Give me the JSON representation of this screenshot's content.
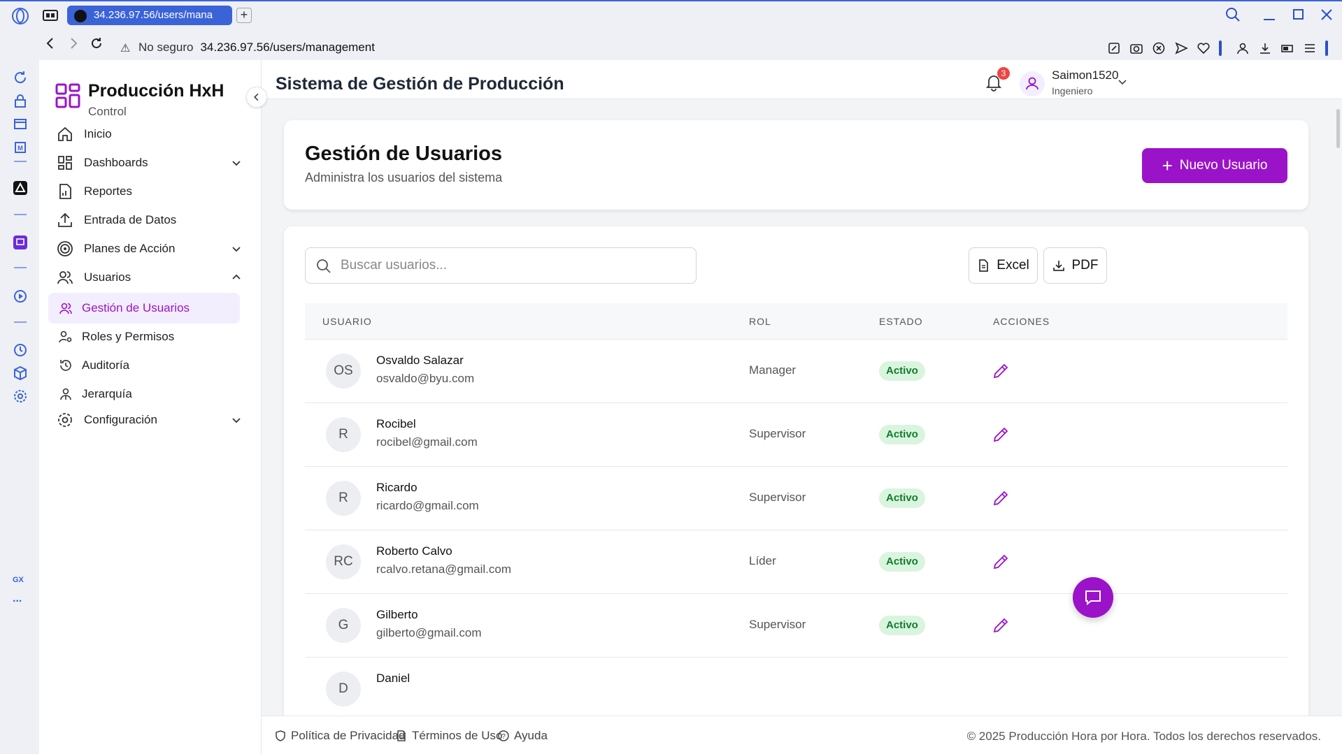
{
  "browser": {
    "tab_title": "34.236.97.56/users/mana",
    "security_label": "No seguro",
    "url": "34.236.97.56/users/management",
    "opera_sidebar_icons": [
      "history-icon",
      "shopping-icon",
      "calendar-icon",
      "manager-icon",
      "aria-icon",
      "twitch-icon",
      "player-icon",
      "clock-icon",
      "cube-icon",
      "settings-icon"
    ],
    "gx_label": "GX",
    "more_label": "..."
  },
  "brand": {
    "title": "Producción HxH",
    "subtitle": "Control"
  },
  "sidebar": {
    "items": [
      {
        "label": "Inicio",
        "icon": "home-icon"
      },
      {
        "label": "Dashboards",
        "icon": "dashboard-icon"
      },
      {
        "label": "Reportes",
        "icon": "report-icon"
      },
      {
        "label": "Entrada de Datos",
        "icon": "upload-icon"
      },
      {
        "label": "Planes de Acción",
        "icon": "target-icon"
      },
      {
        "label": "Usuarios",
        "icon": "users-icon"
      },
      {
        "label": "Configuración",
        "icon": "gear-icon"
      }
    ],
    "subitems": [
      {
        "label": "Gestión de Usuarios",
        "icon": "users-icon",
        "active": true
      },
      {
        "label": "Roles y Permisos",
        "icon": "user-key-icon",
        "active": false
      },
      {
        "label": "Auditoría",
        "icon": "history-icon",
        "active": false
      },
      {
        "label": "Jerarquía",
        "icon": "hierarchy-icon",
        "active": false
      }
    ]
  },
  "header": {
    "title": "Sistema de Gestión de Producción",
    "notification_count": "3",
    "user_name": "Saimon1520",
    "user_role": "Ingeniero"
  },
  "page": {
    "title": "Gestión de Usuarios",
    "subtitle": "Administra los usuarios del sistema",
    "new_user_label": "Nuevo Usuario"
  },
  "table": {
    "search_placeholder": "Buscar usuarios...",
    "excel_label": "Excel",
    "pdf_label": "PDF",
    "columns": [
      "USUARIO",
      "ROL",
      "ESTADO",
      "ACCIONES"
    ],
    "rows": [
      {
        "initials": "OS",
        "name": "Osvaldo Salazar",
        "email": "osvaldo@byu.com",
        "role": "Manager",
        "status": "Activo"
      },
      {
        "initials": "R",
        "name": "Rocibel",
        "email": "rocibel@gmail.com",
        "role": "Supervisor",
        "status": "Activo"
      },
      {
        "initials": "R",
        "name": "Ricardo",
        "email": "ricardo@gmail.com",
        "role": "Supervisor",
        "status": "Activo"
      },
      {
        "initials": "RC",
        "name": "Roberto Calvo",
        "email": "rcalvo.retana@gmail.com",
        "role": "Líder",
        "status": "Activo"
      },
      {
        "initials": "G",
        "name": "Gilberto",
        "email": "gilberto@gmail.com",
        "role": "Supervisor",
        "status": "Activo"
      },
      {
        "initials": "D",
        "name": "Daniel",
        "email": "",
        "role": "",
        "status": ""
      }
    ]
  },
  "footer": {
    "privacy": "Política de Privacidad",
    "terms": "Términos de Uso",
    "help": "Ayuda",
    "copyright": "© 2025 Producción Hora por Hora. Todos los derechos reservados."
  },
  "colors": {
    "accent": "#9b13c9",
    "status_bg": "#d9f5dd",
    "status_text": "#147a31",
    "browser_accent": "#3b63d8"
  }
}
